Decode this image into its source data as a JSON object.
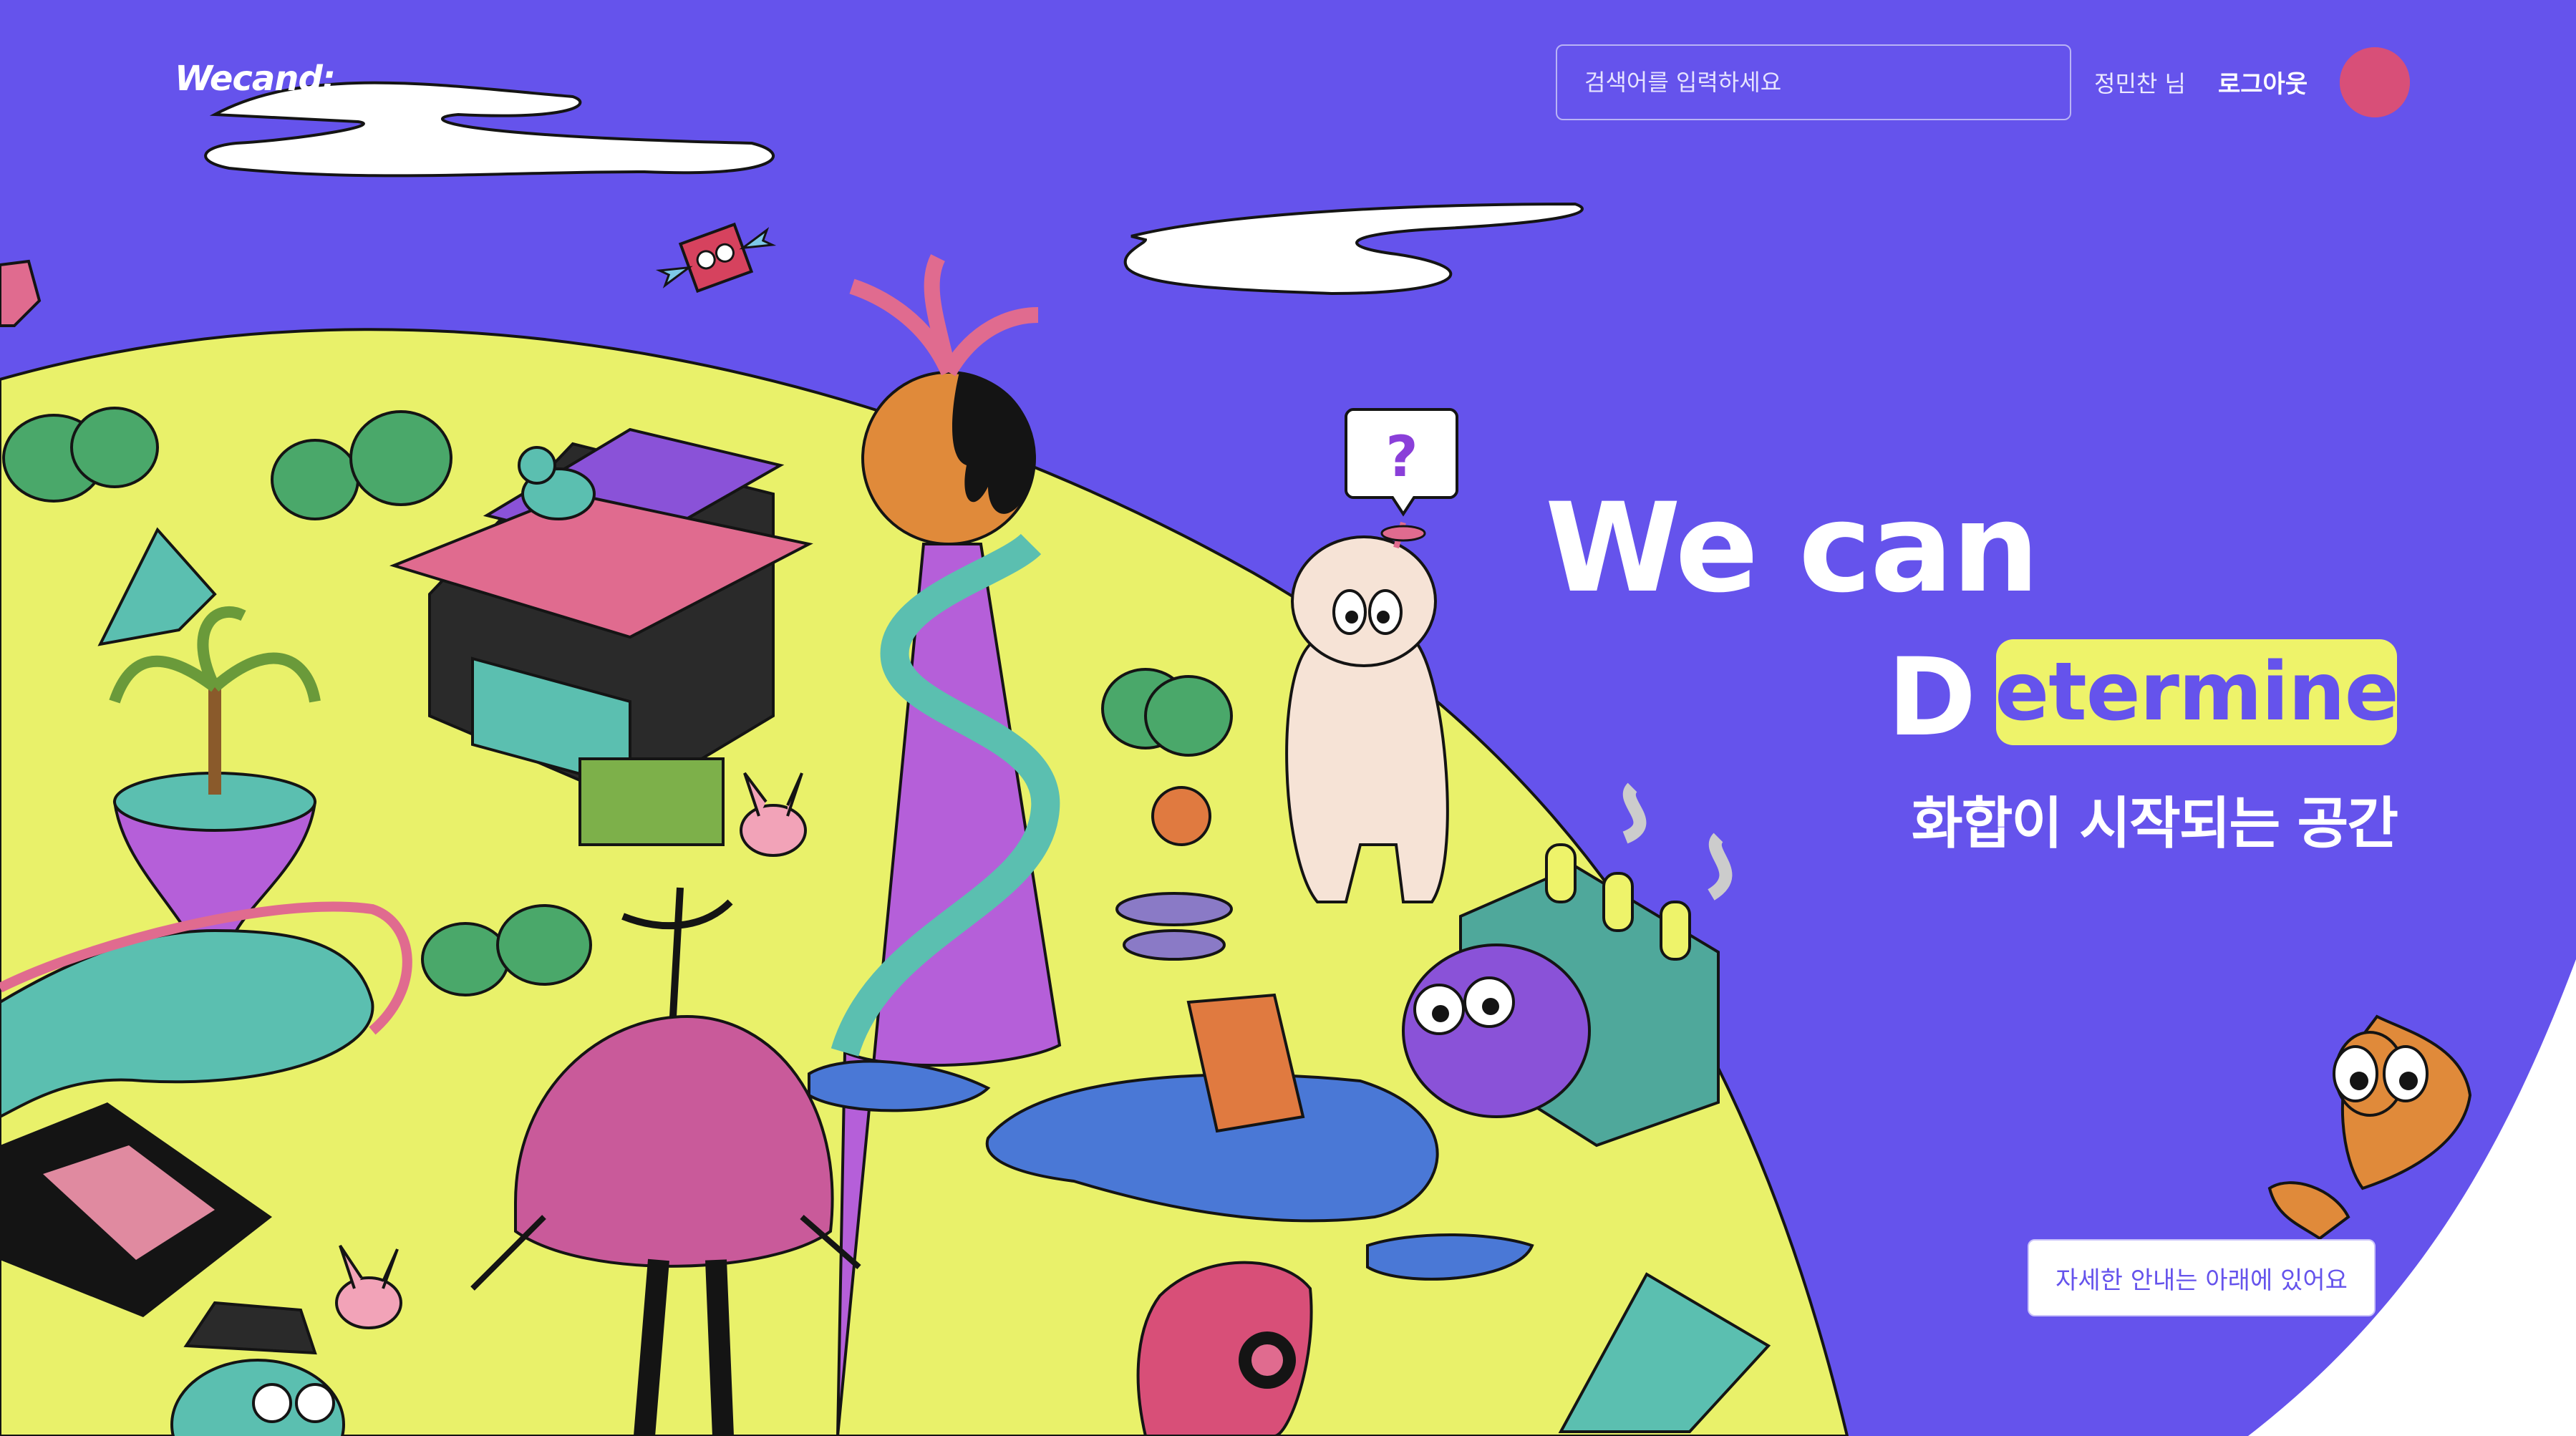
{
  "header": {
    "logo": "Wecand:",
    "search_placeholder": "검색어를 입력하세요",
    "user_name": "정민찬 님",
    "logout_label": "로그아웃"
  },
  "hero": {
    "line1": "We can",
    "line2_letter": "D",
    "line2_highlight": "etermine",
    "subtitle": "화합이 시작되는 공간",
    "speech_bubble": "?"
  },
  "cta": {
    "guide_label": "자세한 안내는 아래에 있어요"
  },
  "colors": {
    "background_purple": "#6553ec",
    "island_yellow": "#e9f16a",
    "highlight_yellow": "#eef36a",
    "white": "#ffffff"
  }
}
